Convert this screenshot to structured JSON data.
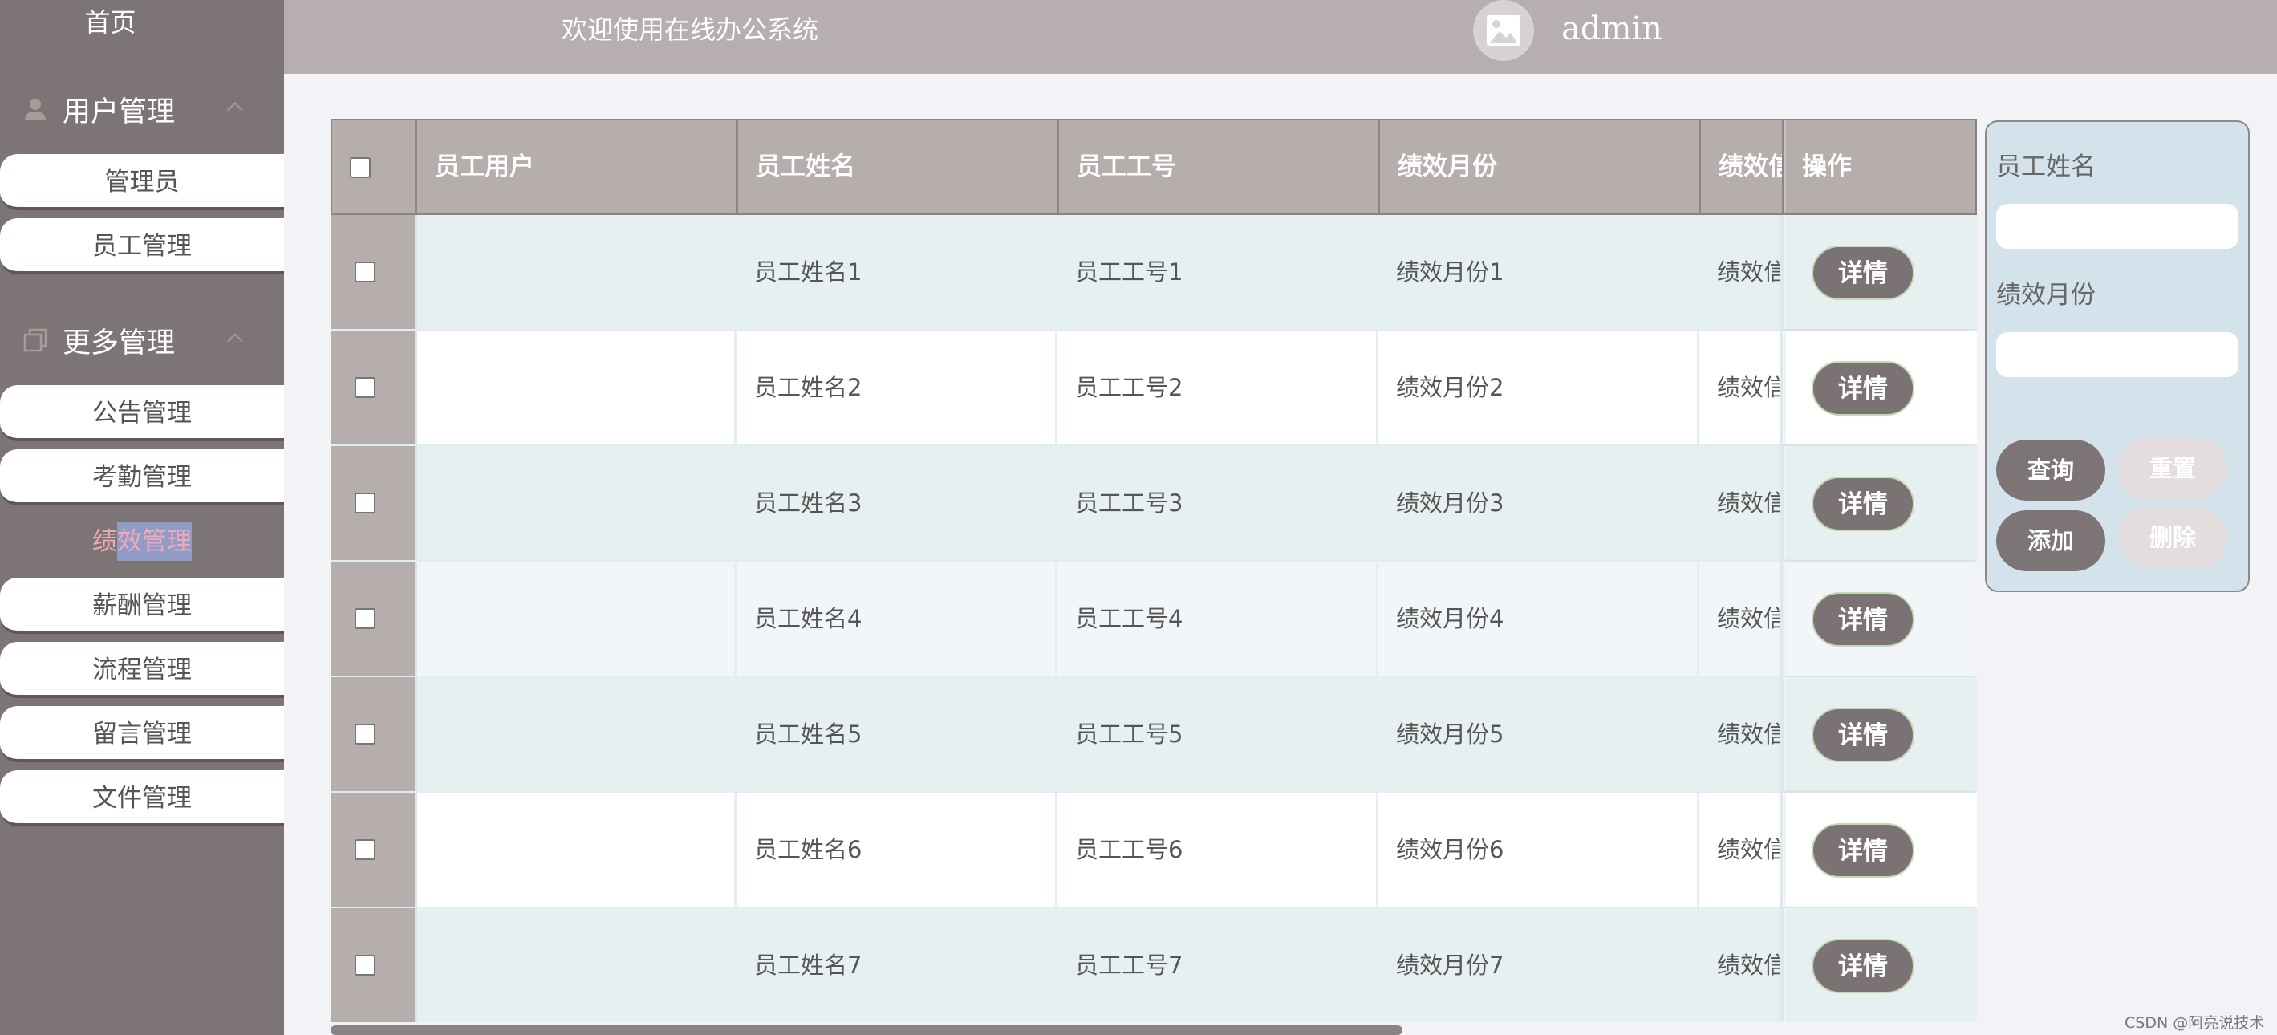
{
  "sidebar": {
    "home": "首页",
    "groups": [
      {
        "label": "用户管理",
        "icon": "user-icon",
        "items": [
          "管理员",
          "员工管理"
        ]
      },
      {
        "label": "更多管理",
        "icon": "copy-icon",
        "items": [
          "公告管理",
          "考勤管理",
          "绩效管理",
          "薪酬管理",
          "流程管理",
          "留言管理",
          "文件管理"
        ]
      }
    ],
    "active_item": "绩效管理"
  },
  "header": {
    "title": "欢迎使用在线办公系统",
    "username": "admin",
    "avatar_icon": "image-icon"
  },
  "table": {
    "columns": [
      "员工用户",
      "员工姓名",
      "员工工号",
      "绩效月份",
      "绩效信",
      "操作"
    ],
    "rows": [
      {
        "user": "",
        "name": "员工姓名1",
        "number": "员工工号1",
        "month": "绩效月份1",
        "info": "绩效信",
        "action": "详情"
      },
      {
        "user": "",
        "name": "员工姓名2",
        "number": "员工工号2",
        "month": "绩效月份2",
        "info": "绩效信",
        "action": "详情"
      },
      {
        "user": "",
        "name": "员工姓名3",
        "number": "员工工号3",
        "month": "绩效月份3",
        "info": "绩效信",
        "action": "详情"
      },
      {
        "user": "",
        "name": "员工姓名4",
        "number": "员工工号4",
        "month": "绩效月份4",
        "info": "绩效信",
        "action": "详情"
      },
      {
        "user": "",
        "name": "员工姓名5",
        "number": "员工工号5",
        "month": "绩效月份5",
        "info": "绩效信",
        "action": "详情"
      },
      {
        "user": "",
        "name": "员工姓名6",
        "number": "员工工号6",
        "month": "绩效月份6",
        "info": "绩效信",
        "action": "详情"
      },
      {
        "user": "",
        "name": "员工姓名7",
        "number": "员工工号7",
        "month": "绩效月份7",
        "info": "绩效信",
        "action": "详情"
      }
    ]
  },
  "search": {
    "name_label": "员工姓名",
    "name_value": "",
    "month_label": "绩效月份",
    "month_value": "",
    "query_btn": "查询",
    "reset_btn": "重置",
    "add_btn": "添加",
    "delete_btn": "删除"
  },
  "watermark": "CSDN @阿亮说技术",
  "colors": {
    "sidebar": "#7d7575",
    "header": "#b7afaf",
    "table_header": "#b6adad",
    "row_odd": "#e7f0f1",
    "row_even": "#ffffff",
    "row_alt": "#f2f6f9",
    "button_dark": "#7b7373",
    "panel": "#d4e3eb",
    "active_text": "#f2a8b6"
  }
}
